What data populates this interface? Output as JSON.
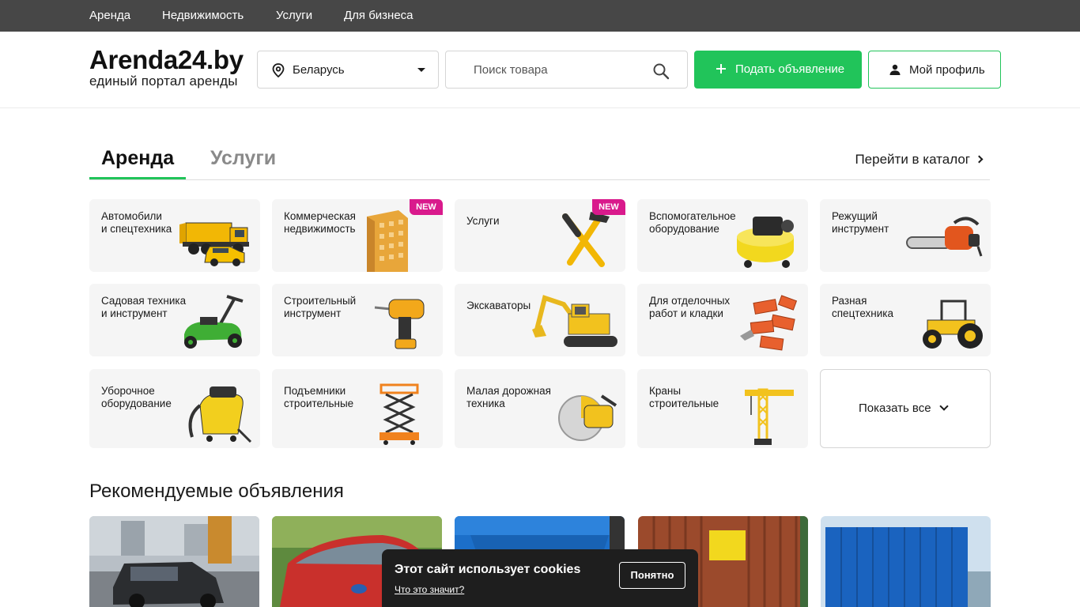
{
  "topnav": {
    "items": [
      {
        "label": "Аренда"
      },
      {
        "label": "Недвижимость"
      },
      {
        "label": "Услуги"
      },
      {
        "label": "Для бизнеса"
      }
    ]
  },
  "header": {
    "logo_name": "Arenda24.by",
    "logo_tagline": "единый портал аренды",
    "region": "Беларусь",
    "search_placeholder": "Поиск товара",
    "post_button": "Подать объявление",
    "profile_button": "Мой профиль"
  },
  "tabs": {
    "items": [
      {
        "label": "Аренда",
        "active": true
      },
      {
        "label": "Услуги",
        "active": false
      }
    ],
    "catalog_link": "Перейти в каталог"
  },
  "categories": [
    {
      "label": "Автомобили\nи спецтехника",
      "icon": "truck-image",
      "badge": ""
    },
    {
      "label": "Коммерческая\nнедвижимость",
      "icon": "building-image",
      "badge": "NEW"
    },
    {
      "label": "Услуги",
      "icon": "tools-image",
      "badge": "NEW"
    },
    {
      "label": "Вспомогательное\nоборудование",
      "icon": "compressor-image",
      "badge": ""
    },
    {
      "label": "Режущий\nинструмент",
      "icon": "chainsaw-image",
      "badge": ""
    },
    {
      "label": "Садовая техника\nи инструмент",
      "icon": "lawnmower-image",
      "badge": ""
    },
    {
      "label": "Строительный\nинструмент",
      "icon": "drill-image",
      "badge": ""
    },
    {
      "label": "Экскаваторы",
      "icon": "excavator-image",
      "badge": ""
    },
    {
      "label": "Для отделочных\nработ и кладки",
      "icon": "bricks-image",
      "badge": ""
    },
    {
      "label": "Разная\nспецтехника",
      "icon": "tractor-image",
      "badge": ""
    },
    {
      "label": "Уборочное\nоборудование",
      "icon": "vacuum-image",
      "badge": ""
    },
    {
      "label": "Подъемники\nстроительные",
      "icon": "scissor-lift-image",
      "badge": ""
    },
    {
      "label": "Малая дорожная\nтехника",
      "icon": "cutter-image",
      "badge": ""
    },
    {
      "label": "Краны\nстроительные",
      "icon": "crane-image",
      "badge": ""
    }
  ],
  "show_all": "Показать все",
  "recommended": {
    "title": "Рекомендуемые объявления",
    "listings": [
      {
        "image": "dark-suv-photo"
      },
      {
        "image": "red-car-photo"
      },
      {
        "image": "blue-container-photo"
      },
      {
        "image": "rusty-container-photo"
      },
      {
        "image": "blue-cabin-photo"
      }
    ]
  },
  "cookie": {
    "title": "Этот сайт использует cookies",
    "link": "Что это значит?",
    "button": "Понятно"
  },
  "colors": {
    "accent": "#21c45a",
    "topnav_bg": "#474747",
    "badge": "#d91a8c",
    "tile_bg": "#f5f5f5"
  }
}
